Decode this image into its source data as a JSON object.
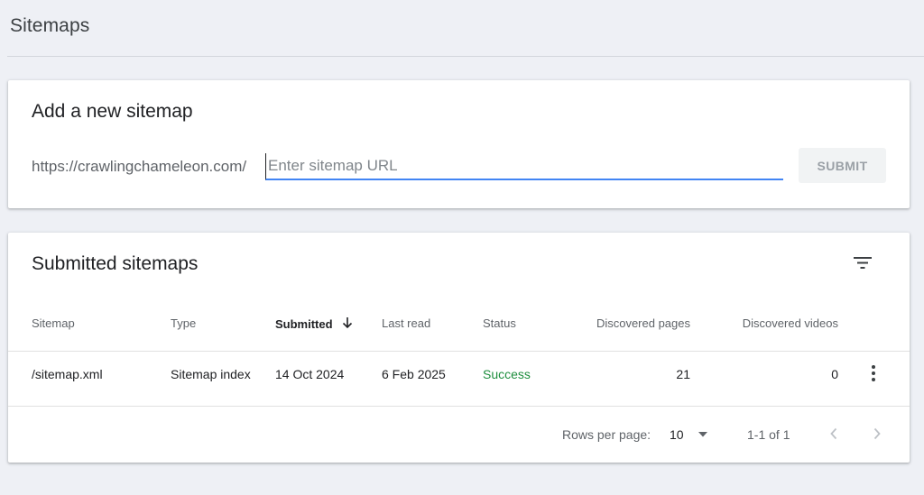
{
  "page": {
    "title": "Sitemaps"
  },
  "add_sitemap": {
    "heading": "Add a new sitemap",
    "url_prefix": "https://crawlingchameleon.com/",
    "input_value": "",
    "input_placeholder": "Enter sitemap URL",
    "submit_label": "SUBMIT"
  },
  "submitted": {
    "heading": "Submitted sitemaps",
    "filter_icon": "filter-list-icon",
    "sort_icon": "arrow-downward-icon",
    "columns": {
      "sitemap": "Sitemap",
      "type": "Type",
      "submitted": "Submitted",
      "last_read": "Last read",
      "status": "Status",
      "discovered_pages": "Discovered pages",
      "discovered_videos": "Discovered videos"
    },
    "rows": [
      {
        "sitemap": "/sitemap.xml",
        "type": "Sitemap index",
        "submitted": "14 Oct 2024",
        "last_read": "6 Feb 2025",
        "status": "Success",
        "discovered_pages": "21",
        "discovered_videos": "0",
        "more_icon": "more-vert-icon"
      }
    ],
    "footer": {
      "rows_per_page_label": "Rows per page:",
      "rows_per_page_value": "10",
      "page_range": "1-1 of 1"
    }
  },
  "colors": {
    "background": "#eef0f5",
    "accent": "#4285f4",
    "success": "#1e8e3e",
    "muted_text": "#5f6368"
  }
}
